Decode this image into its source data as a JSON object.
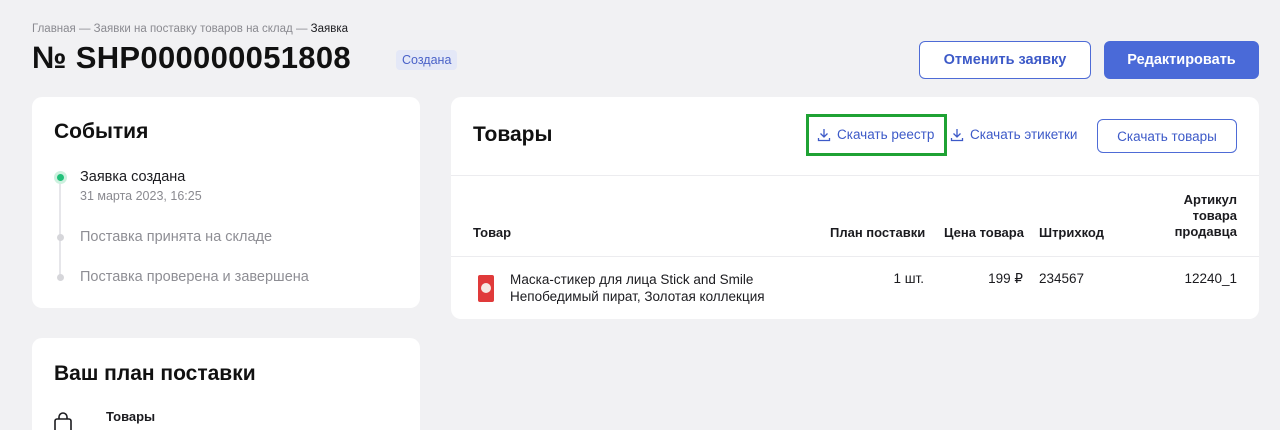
{
  "breadcrumb": {
    "home": "Главная",
    "sep1": " — ",
    "section": "Заявки на поставку товаров на склад",
    "sep2": " — ",
    "current": "Заявка"
  },
  "header": {
    "title": "№ SHP000000051808",
    "status": "Создана",
    "cancel_label": "Отменить заявку",
    "edit_label": "Редактировать"
  },
  "events": {
    "title": "События",
    "items": [
      {
        "label": "Заявка создана",
        "date": "31 марта 2023, 16:25",
        "active": true
      },
      {
        "label": "Поставка принята на складе",
        "active": false
      },
      {
        "label": "Поставка проверена и завершена",
        "active": false
      }
    ]
  },
  "plan": {
    "title": "Ваш план поставки",
    "goods_label": "Товары"
  },
  "goods": {
    "title": "Товары",
    "download_registry": "Скачать реестр",
    "download_labels": "Скачать этикетки",
    "download_goods": "Скачать товары",
    "columns": {
      "product": "Товар",
      "plan": "План поставки",
      "price": "Цена товара",
      "barcode": "Штрихкод",
      "article_line1": "Артикул",
      "article_line2": "товара",
      "article_line3": "продавца"
    },
    "rows": [
      {
        "name_line1": "Маска-стикер для лица Stick and Smile",
        "name_line2": "Непобедимый пират, Золотая коллекция",
        "plan": "1 шт.",
        "price": "199 ₽",
        "barcode": "234567",
        "article": "12240_1"
      }
    ]
  },
  "colors": {
    "accent": "#4a6ad8",
    "active_dot": "#21c07a",
    "highlight": "#1fa234",
    "background": "#f1f1f3"
  }
}
